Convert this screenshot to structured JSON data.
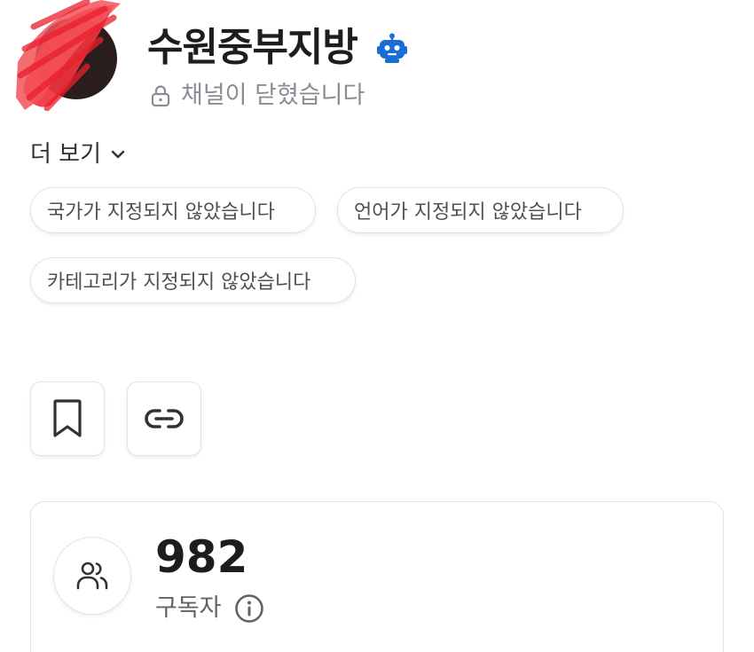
{
  "channel": {
    "name": "수원중부지방",
    "status": "채널이 닫혔습니다",
    "avatar_icon": "avatar-redacted",
    "bot_icon": "robot-icon"
  },
  "more": {
    "label": "더 보기"
  },
  "chips": [
    {
      "label": "국가가 지정되지 않았습니다"
    },
    {
      "label": "언어가 지정되지 않았습니다"
    },
    {
      "label": "카테고리가 지정되지 않았습니다"
    }
  ],
  "actions": {
    "bookmark_icon": "bookmark-icon",
    "link_icon": "link-icon"
  },
  "stats": {
    "subscribers_count": "982",
    "subscribers_label": "구독자"
  },
  "colors": {
    "accent_blue": "#1a6dd6",
    "text_primary": "#1d1d1f",
    "text_muted": "#8a8d93",
    "border": "#e1e3e7",
    "redaction_red": "#f0323c"
  }
}
